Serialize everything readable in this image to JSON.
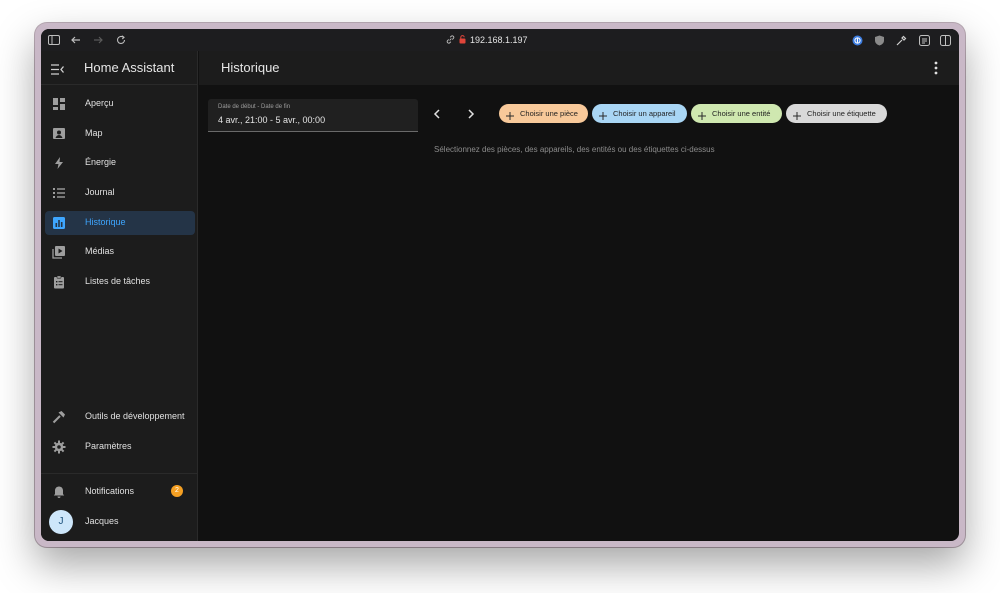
{
  "browser": {
    "url": "192.168.1.197"
  },
  "sidebar": {
    "app_title": "Home Assistant",
    "items": [
      {
        "label": "Aperçu",
        "icon": "dashboard-icon"
      },
      {
        "label": "Map",
        "icon": "map-icon"
      },
      {
        "label": "Énergie",
        "icon": "lightning-icon"
      },
      {
        "label": "Journal",
        "icon": "list-icon"
      },
      {
        "label": "Historique",
        "icon": "chart-box-icon",
        "active": true
      },
      {
        "label": "Médias",
        "icon": "play-box-icon"
      },
      {
        "label": "Listes de tâches",
        "icon": "clipboard-list-icon"
      }
    ],
    "bottom_items": [
      {
        "label": "Outils de développement",
        "icon": "hammer-icon"
      },
      {
        "label": "Paramètres",
        "icon": "gear-icon"
      }
    ],
    "notifications": {
      "label": "Notifications",
      "count": "2"
    },
    "user": {
      "initial": "J",
      "name": "Jacques"
    }
  },
  "main": {
    "title": "Historique",
    "date_range": {
      "label": "Date de début - Date de fin",
      "value": "4 avr., 21:00 - 5 avr., 00:00"
    },
    "chips": [
      {
        "label": "Choisir une pièce",
        "color": "#f8c99a"
      },
      {
        "label": "Choisir un appareil",
        "color": "#a9d6f5"
      },
      {
        "label": "Choisir une entité",
        "color": "#cfe8b0"
      },
      {
        "label": "Choisir une étiquette",
        "color": "#d9d9d9"
      }
    ],
    "hint": "Sélectionnez des pièces, des appareils, des entités ou des étiquettes ci-dessus"
  },
  "colors": {
    "accent": "#3ea6ff",
    "badge": "#f5a023"
  }
}
